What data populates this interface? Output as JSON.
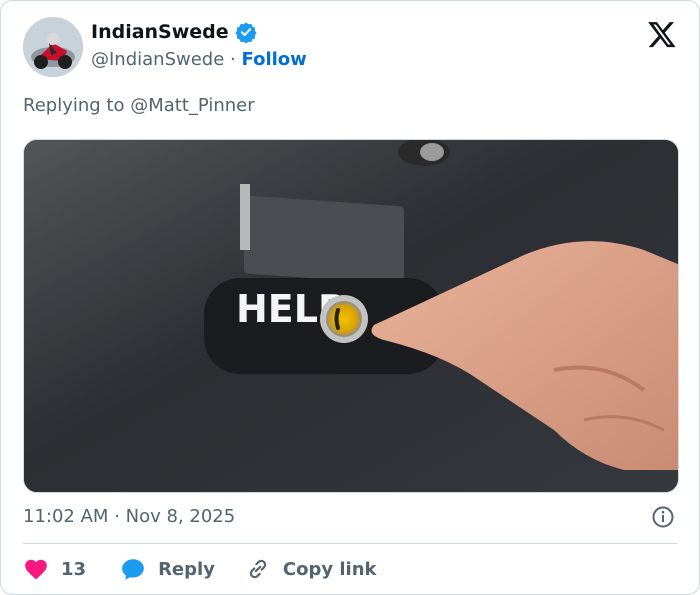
{
  "tweet": {
    "author": {
      "display_name": "IndianSwede",
      "handle": "@IndianSwede",
      "separator": "·",
      "follow_label": "Follow",
      "verified": true,
      "avatar_icon": "motorcycle-rider-avatar"
    },
    "replying_prefix": "Replying to",
    "replying_to": "@Matt_Pinner",
    "media": {
      "description_icon": "elevator-help-button-photo",
      "button_text": "HELP"
    },
    "time": "11:02 AM",
    "date_separator": "·",
    "date": "Nov 8, 2025",
    "likes": "13",
    "reply_label": "Reply",
    "copy_link_label": "Copy link"
  },
  "colors": {
    "brand_link": "#006fd6",
    "like_red": "#f91880",
    "reply_blue": "#1d9bf0",
    "muted_text": "#536471",
    "border": "#cfd9de"
  }
}
